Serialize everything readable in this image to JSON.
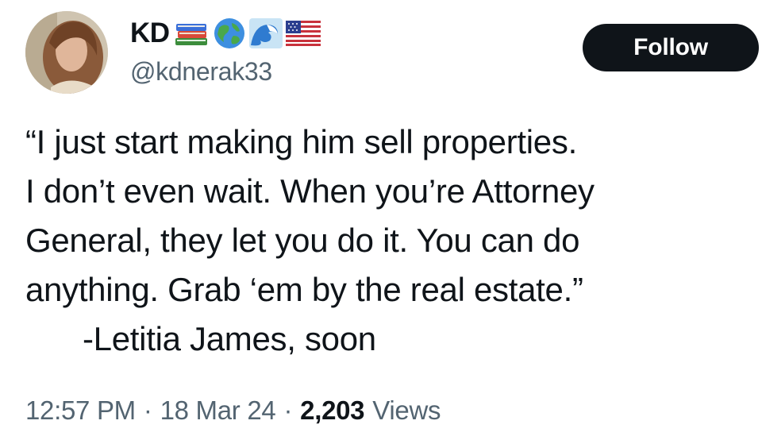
{
  "tweet": {
    "author": {
      "display_name": "KD",
      "handle": "@kdnerak33",
      "avatar_icon": "profile-photo",
      "name_emojis": [
        "books-emoji",
        "globe-emoji",
        "wave-emoji",
        "us-flag-emoji"
      ]
    },
    "follow_label": "Follow",
    "text_lines": [
      "“I just start making him sell properties.",
      "I don’t even wait. When you’re Attorney",
      "General, they let you do it. You can do",
      "anything. Grab ‘em by the real estate.”",
      "-Letitia James, soon"
    ],
    "meta": {
      "time": "12:57 PM",
      "separator": "·",
      "date": "18 Mar 24",
      "views_count": "2,203",
      "views_label": "Views"
    }
  },
  "colors": {
    "text_primary": "#0f1419",
    "text_secondary": "#536471",
    "button_bg": "#0f1419",
    "button_text": "#ffffff"
  }
}
